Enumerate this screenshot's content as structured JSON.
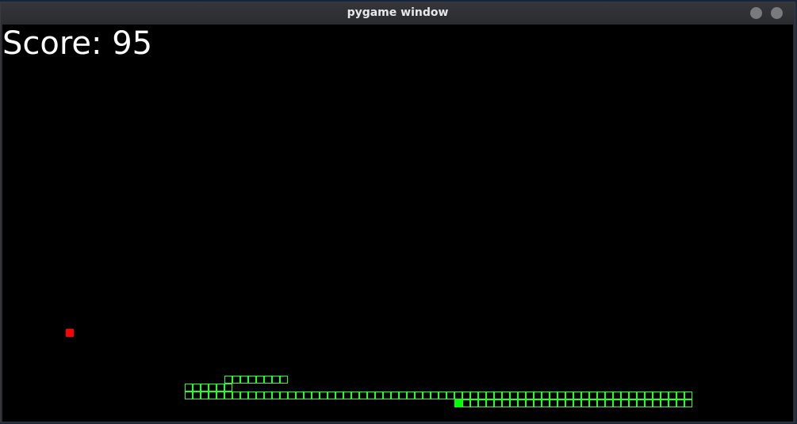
{
  "window": {
    "title": "pygame window"
  },
  "game": {
    "score_label": "Score: 95",
    "colors": {
      "background": "#000000",
      "snake": "#22ff22",
      "head": "#00ff00",
      "food": "#ff0000",
      "text": "#ffffff"
    },
    "grid_cell_size": 10,
    "food": {
      "col": 8,
      "row": 38
    },
    "snake_head": {
      "col": 45,
      "row": 47
    },
    "snake_body": [
      {
        "col": 46,
        "row": 47
      },
      {
        "col": 47,
        "row": 47
      },
      {
        "col": 48,
        "row": 47
      },
      {
        "col": 49,
        "row": 47
      },
      {
        "col": 50,
        "row": 47
      },
      {
        "col": 51,
        "row": 47
      },
      {
        "col": 52,
        "row": 47
      },
      {
        "col": 53,
        "row": 47
      },
      {
        "col": 54,
        "row": 47
      },
      {
        "col": 55,
        "row": 47
      },
      {
        "col": 56,
        "row": 47
      },
      {
        "col": 57,
        "row": 47
      },
      {
        "col": 58,
        "row": 47
      },
      {
        "col": 59,
        "row": 47
      },
      {
        "col": 60,
        "row": 47
      },
      {
        "col": 61,
        "row": 47
      },
      {
        "col": 62,
        "row": 47
      },
      {
        "col": 63,
        "row": 47
      },
      {
        "col": 64,
        "row": 47
      },
      {
        "col": 65,
        "row": 47
      },
      {
        "col": 66,
        "row": 47
      },
      {
        "col": 67,
        "row": 47
      },
      {
        "col": 68,
        "row": 47
      },
      {
        "col": 69,
        "row": 47
      },
      {
        "col": 70,
        "row": 47
      },
      {
        "col": 71,
        "row": 47
      },
      {
        "col": 72,
        "row": 47
      },
      {
        "col": 73,
        "row": 47
      },
      {
        "col": 74,
        "row": 47
      },
      {
        "col": 74,
        "row": 46
      },
      {
        "col": 73,
        "row": 46
      },
      {
        "col": 72,
        "row": 46
      },
      {
        "col": 71,
        "row": 46
      },
      {
        "col": 70,
        "row": 46
      },
      {
        "col": 69,
        "row": 46
      },
      {
        "col": 68,
        "row": 46
      },
      {
        "col": 67,
        "row": 46
      },
      {
        "col": 66,
        "row": 46
      },
      {
        "col": 65,
        "row": 46
      },
      {
        "col": 64,
        "row": 46
      },
      {
        "col": 63,
        "row": 46
      },
      {
        "col": 62,
        "row": 46
      },
      {
        "col": 61,
        "row": 46
      },
      {
        "col": 60,
        "row": 46
      },
      {
        "col": 59,
        "row": 46
      },
      {
        "col": 58,
        "row": 46
      },
      {
        "col": 57,
        "row": 46
      },
      {
        "col": 56,
        "row": 46
      },
      {
        "col": 55,
        "row": 46
      },
      {
        "col": 54,
        "row": 46
      },
      {
        "col": 53,
        "row": 46
      },
      {
        "col": 52,
        "row": 46
      },
      {
        "col": 51,
        "row": 46
      },
      {
        "col": 50,
        "row": 46
      },
      {
        "col": 49,
        "row": 46
      },
      {
        "col": 48,
        "row": 46
      },
      {
        "col": 47,
        "row": 46
      },
      {
        "col": 46,
        "row": 46
      },
      {
        "col": 45,
        "row": 46
      },
      {
        "col": 44,
        "row": 46
      },
      {
        "col": 43,
        "row": 46
      },
      {
        "col": 42,
        "row": 46
      },
      {
        "col": 41,
        "row": 46
      },
      {
        "col": 40,
        "row": 46
      },
      {
        "col": 39,
        "row": 46
      },
      {
        "col": 38,
        "row": 46
      },
      {
        "col": 37,
        "row": 46
      },
      {
        "col": 36,
        "row": 46
      },
      {
        "col": 35,
        "row": 46
      },
      {
        "col": 34,
        "row": 46
      },
      {
        "col": 33,
        "row": 46
      },
      {
        "col": 32,
        "row": 46
      },
      {
        "col": 31,
        "row": 46
      },
      {
        "col": 30,
        "row": 46
      },
      {
        "col": 29,
        "row": 46
      },
      {
        "col": 28,
        "row": 46
      },
      {
        "col": 27,
        "row": 46
      },
      {
        "col": 26,
        "row": 46
      },
      {
        "col": 25,
        "row": 46
      },
      {
        "col": 24,
        "row": 46
      },
      {
        "col": 23,
        "row": 46
      },
      {
        "col": 22,
        "row": 46
      },
      {
        "col": 21,
        "row": 46
      },
      {
        "col": 20,
        "row": 46
      },
      {
        "col": 19,
        "row": 46
      },
      {
        "col": 18,
        "row": 46
      },
      {
        "col": 17,
        "row": 46
      },
      {
        "col": 16,
        "row": 46
      },
      {
        "col": 15,
        "row": 46
      },
      {
        "col": 14,
        "row": 46
      },
      {
        "col": 13,
        "row": 46
      },
      {
        "col": 12,
        "row": 46
      },
      {
        "col": 11,
        "row": 46
      },
      {
        "col": 11,
        "row": 45
      },
      {
        "col": 12,
        "row": 45
      },
      {
        "col": 13,
        "row": 45
      },
      {
        "col": 14,
        "row": 45
      },
      {
        "col": 15,
        "row": 45
      },
      {
        "col": 16,
        "row": 45
      },
      {
        "col": 16,
        "row": 44
      },
      {
        "col": 17,
        "row": 44
      },
      {
        "col": 18,
        "row": 44
      },
      {
        "col": 19,
        "row": 44
      },
      {
        "col": 20,
        "row": 44
      },
      {
        "col": 21,
        "row": 44
      },
      {
        "col": 22,
        "row": 44
      },
      {
        "col": 23,
        "row": 44
      }
    ]
  }
}
